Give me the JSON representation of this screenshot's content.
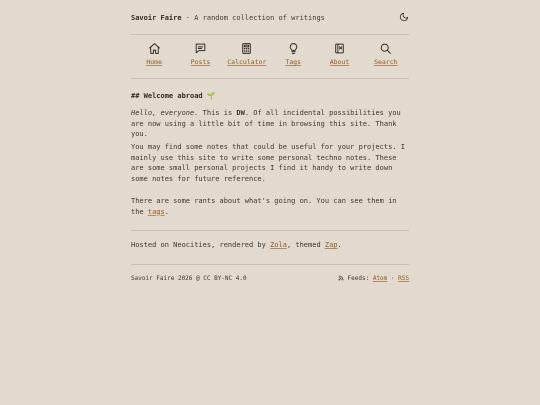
{
  "header": {
    "site_title": "Savoir Faire",
    "separator": "·",
    "tagline": "A random collection of writings",
    "theme_toggle_icon": "moon-icon"
  },
  "nav": {
    "items": [
      {
        "label": "Home",
        "icon": "home-icon"
      },
      {
        "label": "Posts",
        "icon": "message-icon"
      },
      {
        "label": "Calculator",
        "icon": "calculator-icon"
      },
      {
        "label": "Tags",
        "icon": "lightbulb-icon"
      },
      {
        "label": "About",
        "icon": "notebook-icon"
      },
      {
        "label": "Search",
        "icon": "search-icon"
      }
    ]
  },
  "content": {
    "heading": "## Welcome abroad 🌱",
    "p1": {
      "greeting": "Hello, everyone.",
      "pre": " This is ",
      "name": "DW",
      "post": ". Of all incidental possibilities you are now using a little bit of time in browsing this site. Thank you."
    },
    "p2": "You may find some notes that could be useful for your projects. I mainly use this site to write some personal techno notes. These are some small personal projects I find it handy to write down some notes for future reference.",
    "p3": {
      "pre": "There are some rants about what's going on. You can see them in the ",
      "link": "tags",
      "post": "."
    },
    "hosted": {
      "pre": "Hosted on Neocities, rendered by ",
      "link1": "Zola",
      "mid": ", themed ",
      "link2": "Zap",
      "post": "."
    }
  },
  "footer": {
    "copyright": "Savoir Faire 2026 @ CC BY-NC 4.0",
    "feeds_label": "Feeds:",
    "atom": "Atom",
    "sep": "·",
    "rss": "RSS"
  },
  "colors": {
    "background": "#e2dace",
    "accent": "#8a5a22",
    "text": "#2f2b26"
  }
}
